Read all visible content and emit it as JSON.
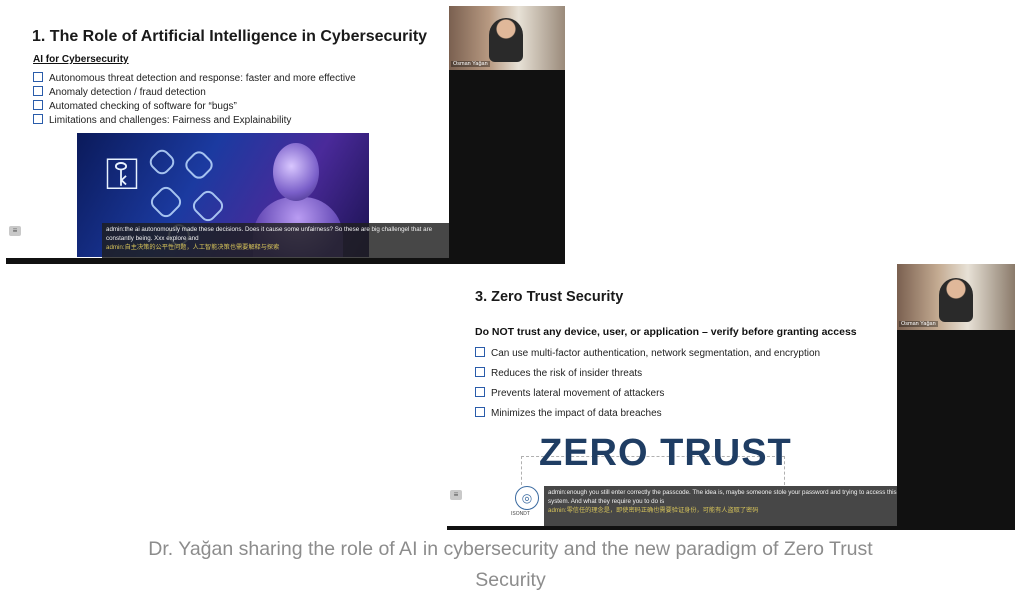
{
  "slide1": {
    "title": "1. The Role of Artificial Intelligence in Cybersecurity",
    "subhead": "AI for Cybersecurity",
    "bullets": [
      "Autonomous threat detection and response: faster and more effective",
      "Anomaly detection / fraud detection",
      "Automated checking of software for “bugs”",
      "Limitations and challenges: Fairness and Explainability"
    ],
    "caption_en": "admin:the ai autonomously made these decisions. Does it cause some unfairness? So these are big challengel that are constantly being. Xxx explore and",
    "caption_cn": "admin:自主决策的公平性问题，人工智能决策也需要解释与探索",
    "video_name": "Osman Yağan"
  },
  "slide2": {
    "title": "3. Zero Trust Security",
    "subhead": "Do NOT trust any device, user, or application – verify before granting access",
    "bullets": [
      "Can use multi-factor authentication, network segmentation, and encryption",
      "Reduces the risk of insider threats",
      "Prevents lateral movement of attackers",
      "Minimizes the impact of data breaches"
    ],
    "graphic_text": "ZERO TRUST",
    "graphic_label": "ISONDT",
    "caption_en": "admin:enough you still enter correctly the passcode. The idea is, maybe someone stole your password and trying to access this system. And what they require you to do is",
    "caption_cn": "admin:零信任的理念是，即使密码正确也需要验证身份，可能有人盗取了密码",
    "video_name": "Osman Yağan"
  },
  "caption": {
    "line1": "Dr. Yağan sharing the role of AI in cybersecurity and the new paradigm of Zero Trust",
    "line2": "Security"
  }
}
